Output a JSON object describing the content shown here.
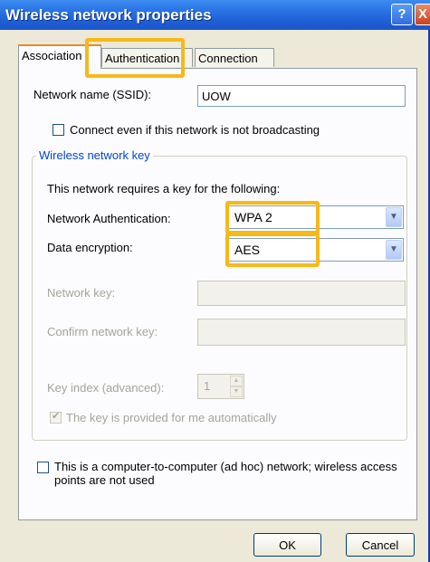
{
  "window": {
    "title": "Wireless network properties",
    "help_label": "?",
    "close_label": "X"
  },
  "tabs": [
    {
      "label": "Association"
    },
    {
      "label": "Authentication"
    },
    {
      "label": "Connection"
    }
  ],
  "network": {
    "ssid_label": "Network name (SSID):",
    "ssid_value": "UOW",
    "broadcast_label": "Connect even if this network is not broadcasting"
  },
  "key_group": {
    "legend": "Wireless network key",
    "intro": "This network requires a key for the following:",
    "auth_label": "Network Authentication:",
    "auth_value": "WPA 2",
    "encryption_label": "Data encryption:",
    "encryption_value": "AES",
    "network_key_label": "Network key:",
    "confirm_key_label": "Confirm network key:",
    "key_index_label": "Key index (advanced):",
    "key_index_value": "1",
    "auto_key_label": "The key is provided for me automatically"
  },
  "adhoc_label": "This is a computer-to-computer (ad hoc) network; wireless access points are not used",
  "buttons": {
    "ok": "OK",
    "cancel": "Cancel"
  },
  "colors": {
    "highlight": "#f8b818",
    "title_bar": "#1f5fd6",
    "group_legend": "#0046d5"
  }
}
